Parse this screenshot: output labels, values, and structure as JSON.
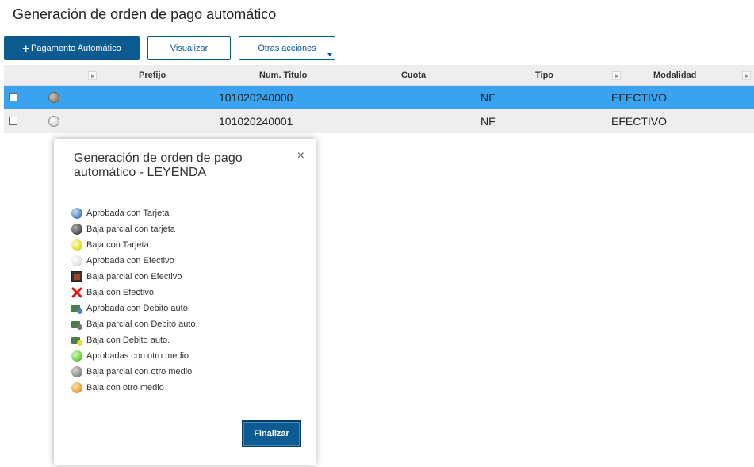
{
  "page": {
    "title": "Generación de orden de pago automático"
  },
  "toolbar": {
    "pagamento_plus": "+",
    "pagamento_label": "Pagamento Automático",
    "visualizar_label": "Visualizar",
    "otras_label": "Otras acciones"
  },
  "grid": {
    "columns": [
      "Prefijo",
      "Num. Titulo",
      "Cuota",
      "Tipo",
      "Modalidad"
    ],
    "rows": [
      {
        "num_titulo": "101020240000",
        "tipo": "NF",
        "modalidad": "EFECTIVO",
        "selected": true
      },
      {
        "num_titulo": "101020240001",
        "tipo": "NF",
        "modalidad": "EFECTIVO",
        "selected": false
      }
    ]
  },
  "modal": {
    "title": "Generación de orden de pago automático - LEYENDA",
    "close": "×",
    "finalizar_label": "Finalizar",
    "legend": [
      {
        "label": "Aprobada con Tarjeta",
        "icon": "blue-ball-icon",
        "color": "#5b8fc9"
      },
      {
        "label": "Baja parcial con tarjeta",
        "icon": "dark-gray-ball-icon",
        "color": "#555555"
      },
      {
        "label": "Baja con Tarjeta",
        "icon": "yellow-ball-icon",
        "color": "#e3e021"
      },
      {
        "label": "Aprobada con Efectivo",
        "icon": "white-ball-icon",
        "color": "#e8e8e8"
      },
      {
        "label": "Baja parcial con Efectivo",
        "icon": "brown-square-icon",
        "color": "#8b3a1a"
      },
      {
        "label": "Baja con Efectivo",
        "icon": "red-x-icon",
        "color": "#dd1111"
      },
      {
        "label": "Aprobada con Debito auto.",
        "icon": "green-folder-blue-ball-icon",
        "color": "#4a7d4a"
      },
      {
        "label": "Baja parcial con Debito auto.",
        "icon": "green-folder-gray-ball-icon",
        "color": "#4a7d4a"
      },
      {
        "label": "Baja con Debito auto.",
        "icon": "green-folder-yellow-ball-icon",
        "color": "#4a7d4a"
      },
      {
        "label": "Aprobadas con otro medio",
        "icon": "green-ball-icon",
        "color": "#6fcf3d"
      },
      {
        "label": "Baja parcial con otro medio",
        "icon": "gray-ball-icon",
        "color": "#8a8a8a"
      },
      {
        "label": "Baja con otro medio",
        "icon": "orange-ball-icon",
        "color": "#e8a23a"
      }
    ]
  }
}
